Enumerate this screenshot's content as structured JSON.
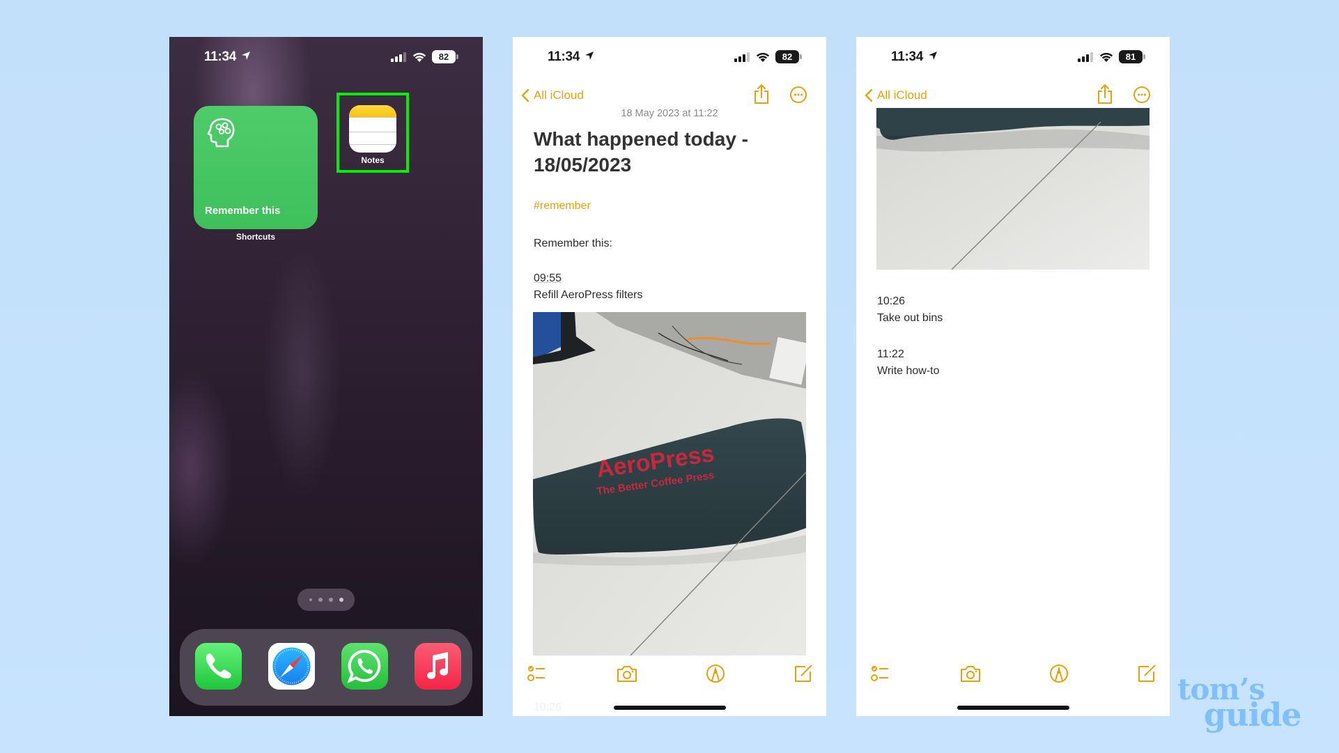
{
  "colors": {
    "notes_accent": "#e6a10b",
    "highlight_box": "#00f000",
    "page_background": "#c4e1fc",
    "widget_green": "#45c460"
  },
  "phone1": {
    "status": {
      "time": "11:34",
      "battery": "82",
      "location_icon": "location-arrow-icon",
      "signal_icon": "cellular-signal-icon",
      "wifi_icon": "wifi-icon"
    },
    "widget": {
      "label": "Remember this",
      "caption": "Shortcuts",
      "icon": "brain-head-icon"
    },
    "notes_app": {
      "label": "Notes",
      "highlighted": true
    },
    "page_indicator": {
      "pages": 4,
      "current": 4
    },
    "dock": [
      {
        "name": "Phone",
        "icon": "phone-icon"
      },
      {
        "name": "Safari",
        "icon": "safari-compass-icon"
      },
      {
        "name": "WhatsApp",
        "icon": "whatsapp-icon"
      },
      {
        "name": "Music",
        "icon": "music-note-icon"
      }
    ]
  },
  "phone2": {
    "status": {
      "time": "11:34",
      "battery": "82"
    },
    "nav": {
      "back_label": "All iCloud",
      "share_icon": "share-icon",
      "more_icon": "more-ellipsis-icon"
    },
    "note": {
      "date": "18 May 2023 at 11:22",
      "title": "What happened today - 18/05/2023",
      "tag": "#remember",
      "intro": "Remember this:",
      "entries": [
        {
          "time": "09:55",
          "text": "Refill AeroPress filters"
        }
      ],
      "photo": {
        "brand": "AeroPress",
        "tagline": "The Better Coffee Press"
      },
      "ghost_time": "10:26"
    },
    "toolbar": [
      "checklist-icon",
      "camera-icon",
      "markup-pen-icon",
      "compose-icon"
    ]
  },
  "phone3": {
    "status": {
      "time": "11:34",
      "battery": "81"
    },
    "nav": {
      "back_label": "All iCloud"
    },
    "note": {
      "entries": [
        {
          "time": "10:26",
          "text": "Take out bins"
        },
        {
          "time": "11:22",
          "text": "Write how-to"
        }
      ]
    },
    "toolbar": [
      "checklist-icon",
      "camera-icon",
      "markup-pen-icon",
      "compose-icon"
    ]
  },
  "watermark": {
    "line1": "tom’s",
    "line2": "guide"
  }
}
